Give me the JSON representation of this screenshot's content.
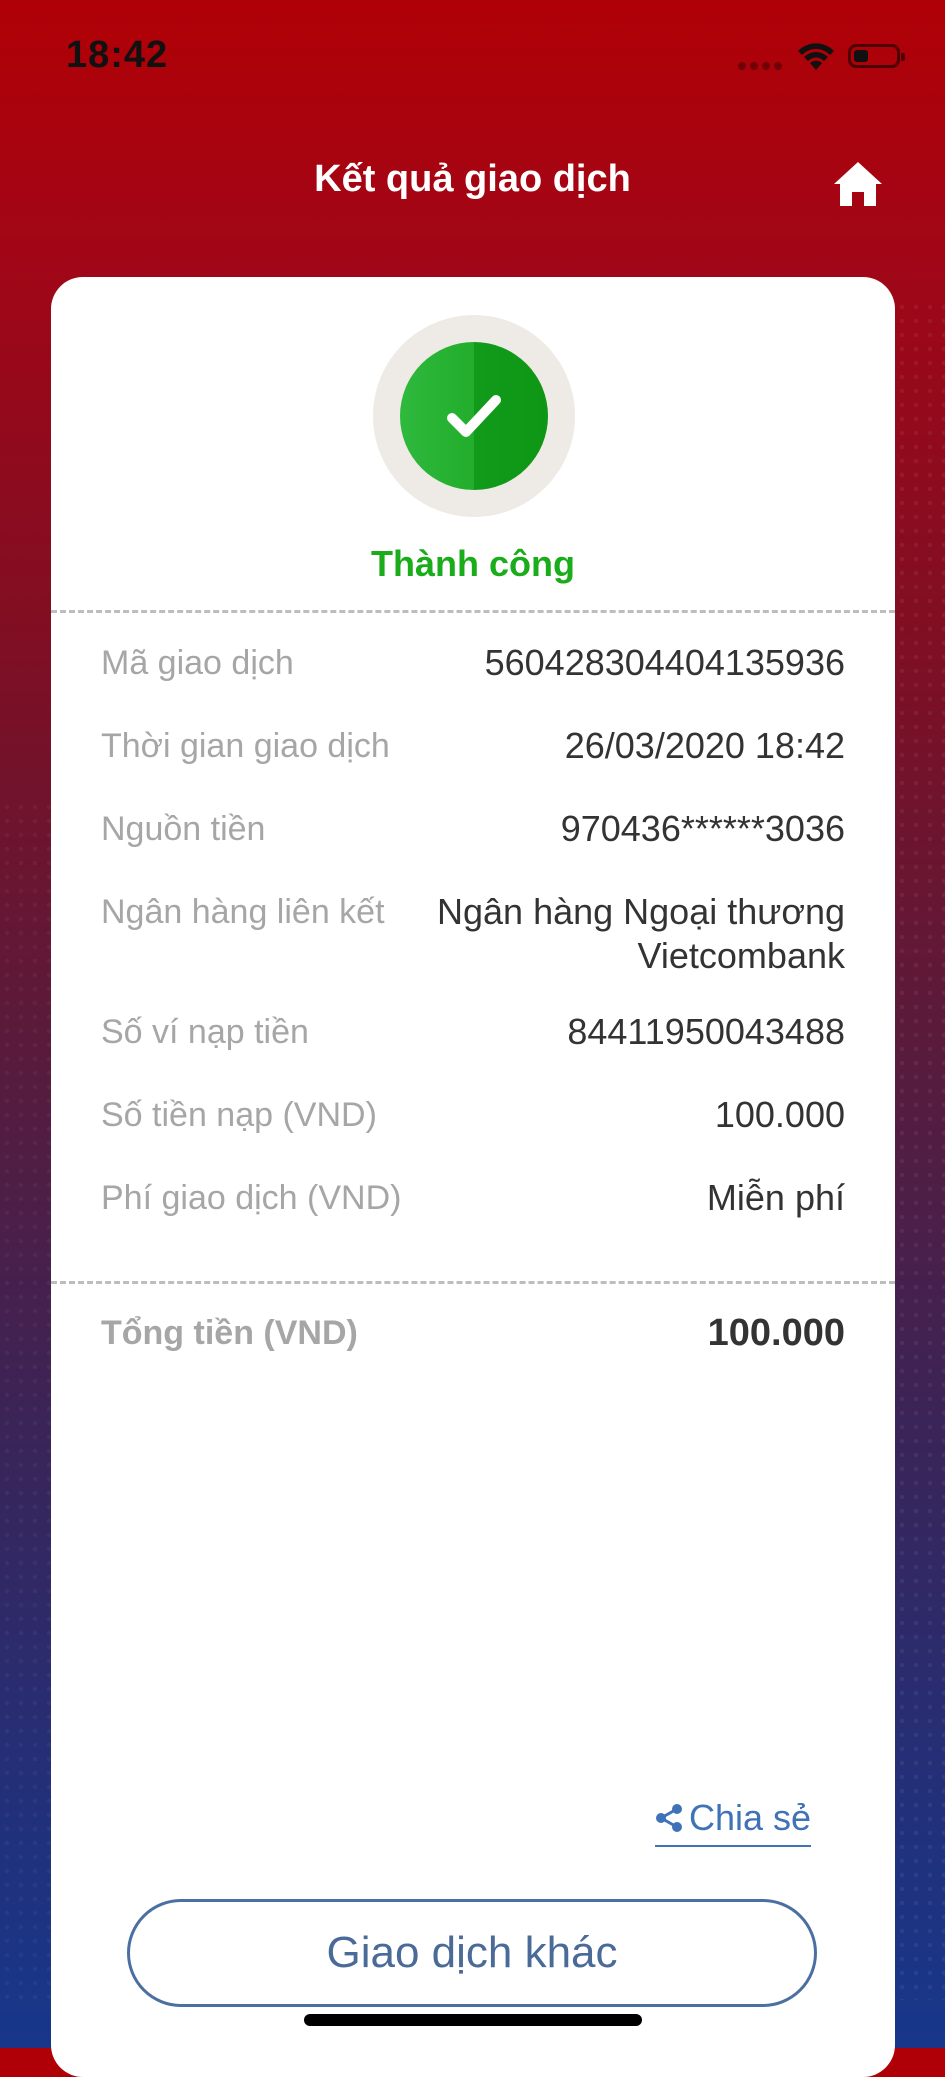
{
  "status_bar": {
    "time": "18:42"
  },
  "header": {
    "title": "Kết quả giao dịch"
  },
  "result": {
    "status": "Thành công",
    "status_color": "#1aac1a"
  },
  "details": [
    {
      "label": "Mã giao dịch",
      "value": "560428304404135936"
    },
    {
      "label": "Thời gian giao dịch",
      "value": "26/03/2020 18:42"
    },
    {
      "label": "Nguồn tiền",
      "value": "970436******3036"
    },
    {
      "label": "Ngân hàng liên kết",
      "value_line1": "Ngân hàng Ngoại thương",
      "value_line2": "Vietcombank"
    },
    {
      "label": "Số ví nạp tiền",
      "value": "84411950043488"
    },
    {
      "label": "Số tiền nạp (VND)",
      "value": "100.000"
    },
    {
      "label": "Phí giao dịch (VND)",
      "value": "Miễn phí"
    }
  ],
  "total": {
    "label": "Tổng tiền (VND)",
    "value": "100.000"
  },
  "share": {
    "label": "Chia sẻ"
  },
  "actions": {
    "other_transaction": "Giao dịch khác"
  },
  "colors": {
    "brand_red": "#b00006",
    "link_blue": "#3f72b6",
    "success_green": "#1aac1a"
  }
}
